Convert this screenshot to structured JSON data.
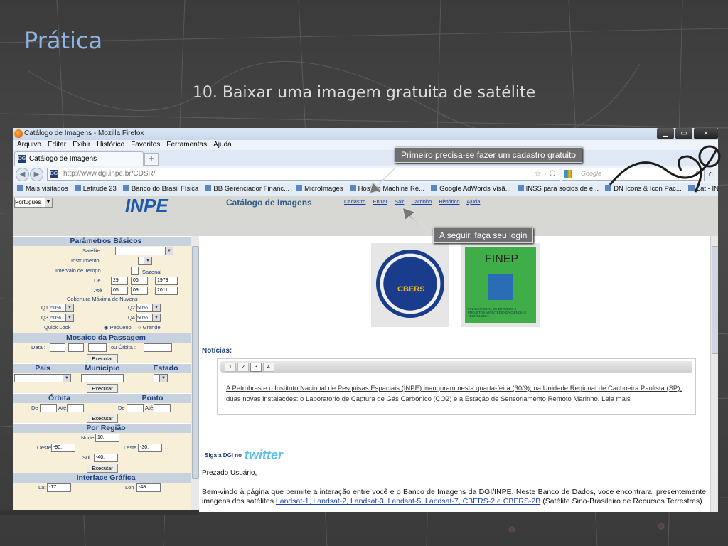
{
  "slide": {
    "title": "Prática",
    "subtitle": "10. Baixar uma imagem gratuita de satélite"
  },
  "browser": {
    "window_title": "Catálogo de Imagens - Mozilla Firefox",
    "window_buttons": [
      "▁",
      "▭",
      "x"
    ],
    "menu": [
      "Arquivo",
      "Editar",
      "Exibir",
      "Histórico",
      "Favoritos",
      "Ferramentas",
      "Ajuda"
    ],
    "tab_label": "Catálogo de Imagens",
    "tab_favicon": "DG",
    "new_tab": "+",
    "nav_back": "◀",
    "nav_forward": "▶",
    "url": "http://www.dgi.inpe.br/CDSR/",
    "star": "☆ · C",
    "search_placeholder": "Google",
    "search_icon": "⌕",
    "home_icon": "⌂",
    "bookmarks": [
      "Mais visitados",
      "Latitude 23",
      "Banco do Brasil Física",
      "BB Gerenciador Financ...",
      "MicroImages",
      "Hosting Machine Re...",
      "Google AdWords Visã...",
      "INSS para sócios de e...",
      "DN Icons & Icon Pac...",
      "Lat - INPE"
    ]
  },
  "page": {
    "language": "Portugues",
    "logo_text": "INPE",
    "catalog_title": "Catálogo de Imagens",
    "top_links": [
      "Cadastro",
      "Entrar",
      "Sair",
      "Carrinho",
      "Histórico",
      "Ajuda"
    ],
    "sidebar": {
      "basic_params": "Parâmetros Básicos",
      "satelite": "Satélite",
      "instrumento": "Instrumento",
      "intervalo": "Intervalo de Tempo",
      "sazonal": "Sazonal",
      "de": "De",
      "ate": "Até",
      "de_day": "29",
      "de_month": "06",
      "de_year": "1973",
      "ate_day": "05",
      "ate_month": "09",
      "ate_year": "2011",
      "nuvens": "Cobertura Máxima de Nuvens",
      "q1": "Q1",
      "q2": "Q2",
      "q3": "Q3",
      "q4": "Q4",
      "q_value": "50%",
      "quicklook": "Quick Look",
      "pequeno": "Pequeno",
      "grande": "Grande",
      "mosaico": "Mosaico da Passagem",
      "data": "Data :",
      "ou_orbita": "ou  Órbita :",
      "executar": "Executar",
      "pais": "País",
      "municipio": "Município",
      "estado": "Estado",
      "orbita": "Órbita",
      "ponto": "Ponto",
      "por_regiao": "Por Região",
      "norte": "Norte",
      "norte_v": "10.",
      "oeste": "Oeste",
      "oeste_v": "-90.",
      "leste": "Leste",
      "leste_v": "-30.",
      "sul": "Sul",
      "sul_v": "-40.",
      "interface": "Interface Gráfica",
      "lat": "Lat",
      "lat_v": "-17.",
      "lon": "Lon",
      "lon_v": "-48."
    },
    "logos": {
      "cbers_text": "CBERS",
      "finep_title": "FINEP",
      "finep_sub": "FINANCIADORA DE ESTUDOS E PROJETOS MINISTÉRIO DA CIÊNCIA E TECNOLOGIA"
    },
    "noticias_label": "Notícias:",
    "pager": [
      "1",
      "2",
      "3",
      "4"
    ],
    "news_text": "A Petrobras e o Instituto Nacional de Pesquisas Espaciais (INPE) inauguram nesta quarta-feira (30/9), na Unidade Regional de Cachoeira Paulista (SP), duas novas instalações: o Laboratório de Captura de Gás Carbônico (CO2) e a Estação de Sensoriamento Remoto Marinho. Leia mais",
    "siga": "Siga a DGI no",
    "twitter": "twitter",
    "prezado": "Prezado Usuário,",
    "bemvindo_1": "Bem-vindo à página que permite a interação entre você e o Banco de Imagens da DGI/INPE. Neste Banco de Dados, voce encontrara, presentemente, imagens dos satélites ",
    "bemvindo_links": "Landsat-1, Landsat-2, Landsat-3, Landsat-5, Landsat-7, CBERS-2 e CBERS-2B",
    "bemvindo_2": " (Satélite Sino-Brasileiro de Recursos Terrestres)"
  },
  "callouts": {
    "cadastro": "Primeiro precisa-se fazer um cadastro gratuito",
    "login": "A seguir, faça seu login"
  }
}
